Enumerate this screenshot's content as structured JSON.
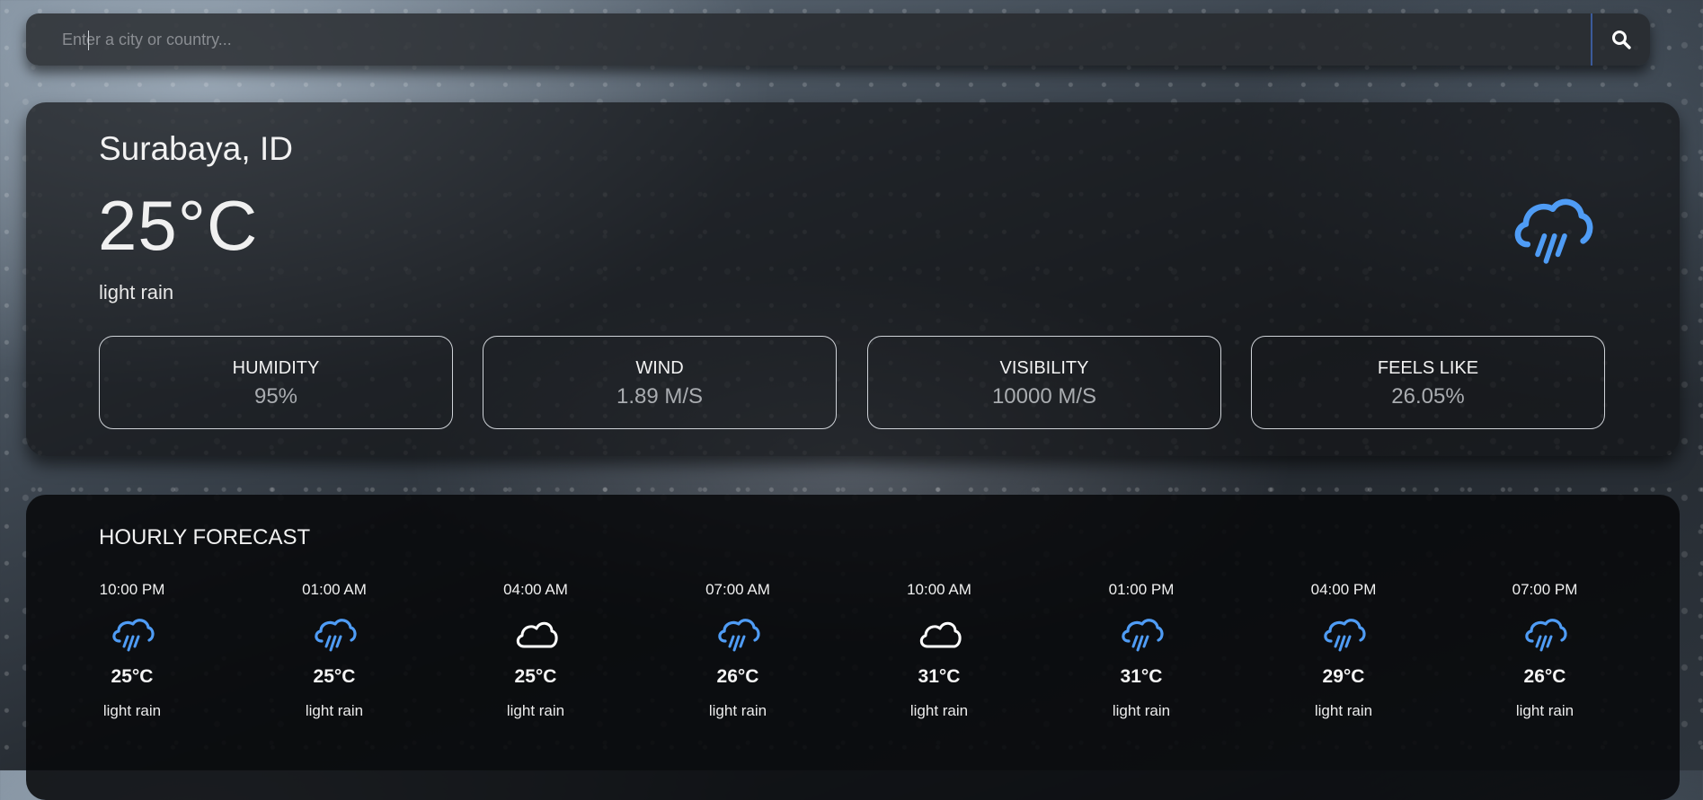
{
  "search": {
    "placeholder": "Enter a city or country..."
  },
  "current": {
    "location": "Surabaya, ID",
    "temperature": "25°C",
    "description": "light rain",
    "icon": "rain-cloud-icon",
    "stats": [
      {
        "label": "HUMIDITY",
        "value": "95%"
      },
      {
        "label": "WIND",
        "value": "1.89 M/S"
      },
      {
        "label": "VISIBILITY",
        "value": "10000 M/S"
      },
      {
        "label": "FEELS LIKE",
        "value": "26.05%"
      }
    ]
  },
  "hourly": {
    "title": "HOURLY FORECAST",
    "items": [
      {
        "time": "10:00 PM",
        "temp": "25°C",
        "desc": "light rain",
        "icon": "rain-cloud-icon"
      },
      {
        "time": "01:00 AM",
        "temp": "25°C",
        "desc": "light rain",
        "icon": "rain-cloud-icon"
      },
      {
        "time": "04:00 AM",
        "temp": "25°C",
        "desc": "light rain",
        "icon": "cloud-icon"
      },
      {
        "time": "07:00 AM",
        "temp": "26°C",
        "desc": "light rain",
        "icon": "rain-cloud-icon"
      },
      {
        "time": "10:00 AM",
        "temp": "31°C",
        "desc": "light rain",
        "icon": "cloud-icon"
      },
      {
        "time": "01:00 PM",
        "temp": "31°C",
        "desc": "light rain",
        "icon": "rain-cloud-icon"
      },
      {
        "time": "04:00 PM",
        "temp": "29°C",
        "desc": "light rain",
        "icon": "rain-cloud-icon"
      },
      {
        "time": "07:00 PM",
        "temp": "26°C",
        "desc": "light rain",
        "icon": "rain-cloud-icon"
      }
    ]
  },
  "colors": {
    "rain_icon": "#4f9cf5",
    "cloud_icon": "#ffffff",
    "search_divider": "#3b5a9a"
  }
}
